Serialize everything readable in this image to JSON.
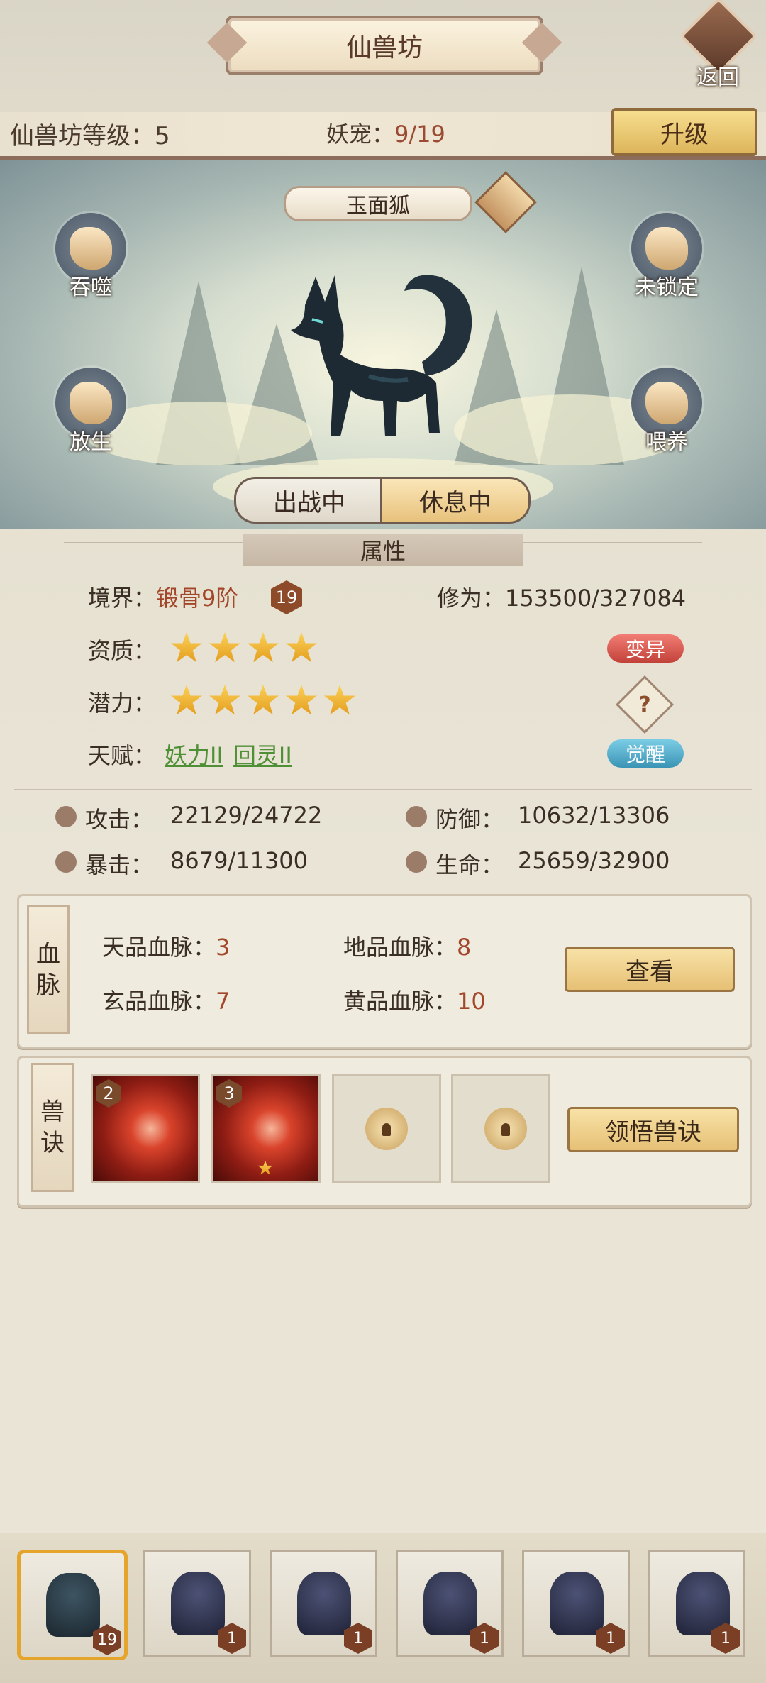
{
  "header": {
    "title": "仙兽坊",
    "back_label": "返回",
    "level_text": "仙兽坊等级：5",
    "pets_prefix": "妖宠：",
    "pets_value": "9/19",
    "upgrade_label": "升级"
  },
  "pet": {
    "name": "玉面狐",
    "actions": {
      "devour": "吞噬",
      "release": "放生",
      "lock": "未锁定",
      "feed": "喂养"
    },
    "state_tabs": {
      "fight": "出战中",
      "rest": "休息中",
      "selected": "休息中"
    }
  },
  "attributes": {
    "title": "属性",
    "realm_label": "境界：",
    "realm_value": "锻骨9阶",
    "realm_badge": "19",
    "cultivation_label": "修为：",
    "cultivation_value": "153500/327084",
    "aptitude_label": "资质：",
    "aptitude_stars": 4,
    "mutate_label": "变异",
    "potential_label": "潜力：",
    "potential_stars": 5,
    "hidden_mark": "?",
    "talent_label": "天赋：",
    "talent_1": "妖力II",
    "talent_2": "回灵II",
    "awaken_label": "觉醒",
    "attack_label": "攻击：",
    "attack_value": "22129/24722",
    "defense_label": "防御：",
    "defense_value": "10632/13306",
    "crit_label": "暴击：",
    "crit_value": "8679/11300",
    "hp_label": "生命：",
    "hp_value": "25659/32900"
  },
  "bloodline": {
    "tag_1": "血",
    "tag_2": "脉",
    "heaven_label": "天品血脉：",
    "heaven_value": "3",
    "earth_label": "地品血脉：",
    "earth_value": "8",
    "mystic_label": "玄品血脉：",
    "mystic_value": "7",
    "yellow_label": "黄品血脉：",
    "yellow_value": "10",
    "view_label": "查看"
  },
  "skills": {
    "tag_1": "兽",
    "tag_2": "诀",
    "slot_1_level": "2",
    "slot_2_level": "3",
    "learn_label": "领悟兽诀"
  },
  "pet_list": {
    "levels": [
      "19",
      "1",
      "1",
      "1",
      "1",
      "1"
    ]
  },
  "colors": {
    "accent_gold": "#e6c075",
    "value_red": "#a3472a",
    "talent_green": "#4f8f36",
    "mutate_pill": "#c2423a",
    "awaken_pill": "#3b94b5"
  }
}
